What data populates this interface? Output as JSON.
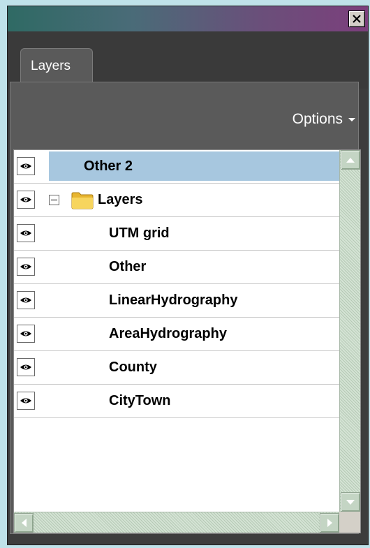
{
  "panel": {
    "tab_label": "Layers",
    "options_label": "Options"
  },
  "layers": [
    {
      "name": "Other 2",
      "selected": true,
      "group": false,
      "indent": 1
    },
    {
      "name": "Layers",
      "selected": false,
      "group": true,
      "indent": 0
    },
    {
      "name": "UTM grid",
      "selected": false,
      "group": false,
      "indent": 2
    },
    {
      "name": "Other",
      "selected": false,
      "group": false,
      "indent": 2
    },
    {
      "name": "LinearHydrography",
      "selected": false,
      "group": false,
      "indent": 2
    },
    {
      "name": "AreaHydrography",
      "selected": false,
      "group": false,
      "indent": 2
    },
    {
      "name": "County",
      "selected": false,
      "group": false,
      "indent": 2
    },
    {
      "name": "CityTown",
      "selected": false,
      "group": false,
      "indent": 2
    }
  ],
  "icons": {
    "visibility": "eye-icon",
    "group_toggle": "collapse-icon",
    "group": "folder-icon",
    "close": "close-icon"
  },
  "colors": {
    "selection": "#a7c7df",
    "panel_bg": "#5a5a5a",
    "titlebar_start": "#2f6a64",
    "titlebar_end": "#7c3f7c"
  }
}
